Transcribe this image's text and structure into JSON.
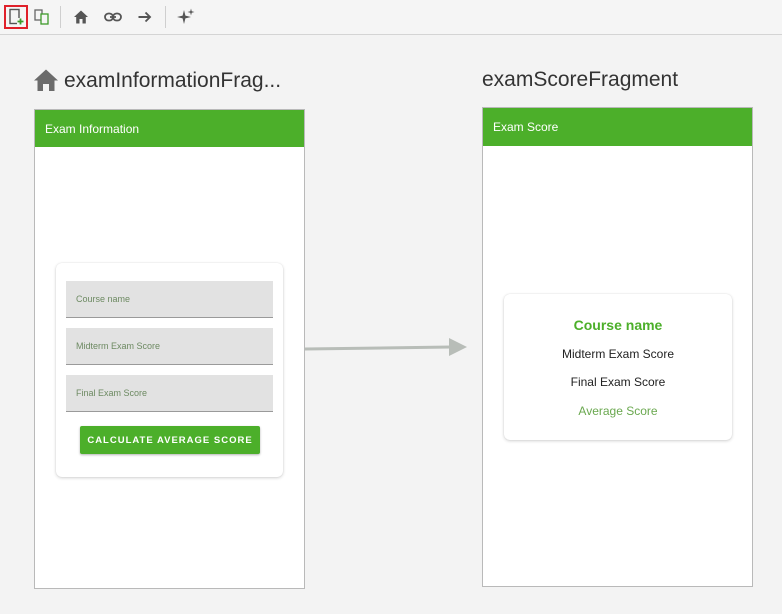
{
  "toolbar": {
    "buttons": [
      {
        "icon": "new-destination-icon",
        "selected": true
      },
      {
        "icon": "copy-destination-icon"
      },
      {
        "icon": "home-icon"
      },
      {
        "icon": "link-icon"
      },
      {
        "icon": "arrow-right-icon"
      },
      {
        "icon": "sparkle-icon"
      }
    ]
  },
  "colors": {
    "accent": "#4caf2a",
    "selected_border": "#e0202a",
    "arrow": "#b8bdb8"
  },
  "destinations": [
    {
      "title": "examInformationFrag...",
      "is_start": true,
      "app_bar_title": "Exam Information",
      "fields": [
        {
          "placeholder": "Course name"
        },
        {
          "placeholder": "Midterm Exam Score"
        },
        {
          "placeholder": "Final Exam Score"
        }
      ],
      "button_label": "CALCULATE AVERAGE SCORE"
    },
    {
      "title": "examScoreFragment",
      "app_bar_title": "Exam Score",
      "lines": {
        "course": "Course name",
        "midterm": "Midterm Exam Score",
        "final": "Final Exam Score",
        "average": "Average Score"
      }
    }
  ]
}
